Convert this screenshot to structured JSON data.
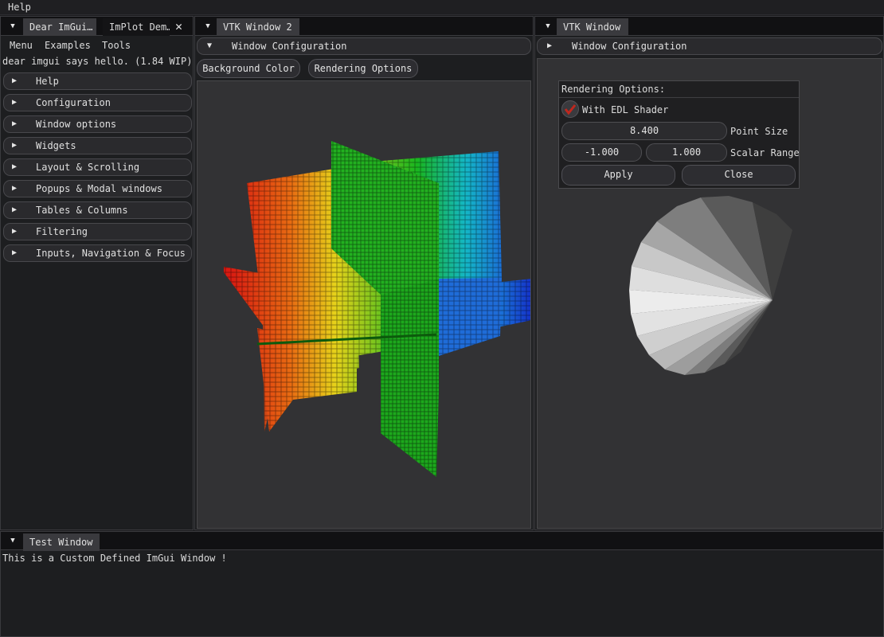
{
  "menubar": {
    "help": "Help"
  },
  "left_pane": {
    "tabs": [
      {
        "label": "Dear ImGui…"
      },
      {
        "label": "ImPlot Dem…"
      }
    ],
    "menu": [
      "Menu",
      "Examples",
      "Tools"
    ],
    "hello_text": "dear imgui says hello. (1.84 WIP)",
    "headers": [
      "Help",
      "Configuration",
      "Window options",
      "Widgets",
      "Layout & Scrolling",
      "Popups & Modal windows",
      "Tables & Columns",
      "Filtering",
      "Inputs, Navigation & Focus"
    ]
  },
  "vtk2": {
    "tab": "VTK Window 2",
    "header": "Window Configuration",
    "buttons": {
      "background": "Background Color",
      "rendering": "Rendering Options"
    }
  },
  "vtk1": {
    "tab": "VTK Window",
    "header": "Window Configuration",
    "popup": {
      "title": "Rendering Options:",
      "edl_label": "With EDL Shader",
      "edl_checked": true,
      "point_size": "8.400",
      "point_size_label": "Point Size",
      "scalar_min": "-1.000",
      "scalar_max": "1.000",
      "scalar_range_label": "Scalar Range",
      "apply": "Apply",
      "close": "Close"
    }
  },
  "bottom": {
    "tab": "Test Window",
    "text": "This is a Custom Defined ImGui Window !"
  }
}
